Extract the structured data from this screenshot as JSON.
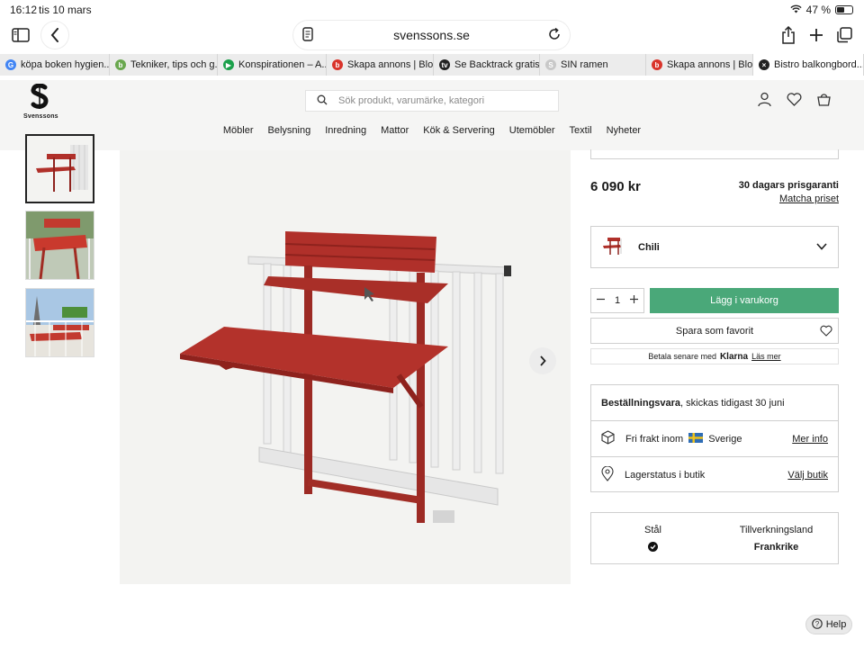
{
  "status": {
    "time": "16:12",
    "date": "tis 10 mars",
    "battery": "47 %",
    "battery_level": 0.47
  },
  "browser": {
    "url": "svenssons.se"
  },
  "tabs": [
    {
      "label": "köpa boken hygien...",
      "icon": "google-icon",
      "color": "#4285f4",
      "glyph": "G"
    },
    {
      "label": "Tekniker, tips och g...",
      "icon": "site-icon",
      "color": "#6aa84f",
      "glyph": "b"
    },
    {
      "label": "Konspirationen – A...",
      "icon": "play-icon",
      "color": "#1aa04a",
      "glyph": "▶"
    },
    {
      "label": "Skapa annons | Blo...",
      "icon": "blocket-icon",
      "color": "#d9342b",
      "glyph": "b"
    },
    {
      "label": "Se Backtrack gratis...",
      "icon": "tv-icon",
      "color": "#222222",
      "glyph": "tv"
    },
    {
      "label": "SIN ramen",
      "icon": "generic-icon",
      "color": "#c8c8c8",
      "glyph": "S"
    },
    {
      "label": "Skapa annons | Blo...",
      "icon": "blocket-icon",
      "color": "#d9342b",
      "glyph": "b"
    },
    {
      "label": "Bistro balkongbord...",
      "icon": "close-icon",
      "color": "#222222",
      "glyph": "×"
    }
  ],
  "header": {
    "logo_text": "Svenssons",
    "search_placeholder": "Sök produkt, varumärke, kategori",
    "nav": [
      "Möbler",
      "Belysning",
      "Inredning",
      "Mattor",
      "Kök & Servering",
      "Utemöbler",
      "Textil",
      "Nyheter"
    ]
  },
  "product": {
    "price": "6 090 kr",
    "guarantee_title": "30 dagars prisgaranti",
    "guarantee_link": "Matcha priset",
    "variant": "Chili",
    "quantity": "1",
    "add_to_cart": "Lägg i varukorg",
    "save_favorite": "Spara som favorit",
    "klarna_prefix": "Betala senare med",
    "klarna_brand": "Klarna",
    "klarna_link": "Läs mer",
    "availability_bold": "Beställningsvara",
    "availability_rest": ", skickas tidigast 30 juni",
    "shipping_text": "Fri frakt inom",
    "shipping_country": "Sverige",
    "shipping_link": "Mer info",
    "stock_text": "Lagerstatus i butik",
    "stock_link": "Välj butik",
    "spec_material_label": "Stål",
    "spec_origin_label": "Tillverkningsland",
    "spec_origin_value": "Frankrike",
    "accent_color": "#4aa879",
    "product_color": "#b0302a"
  },
  "help": {
    "label": "Help"
  }
}
